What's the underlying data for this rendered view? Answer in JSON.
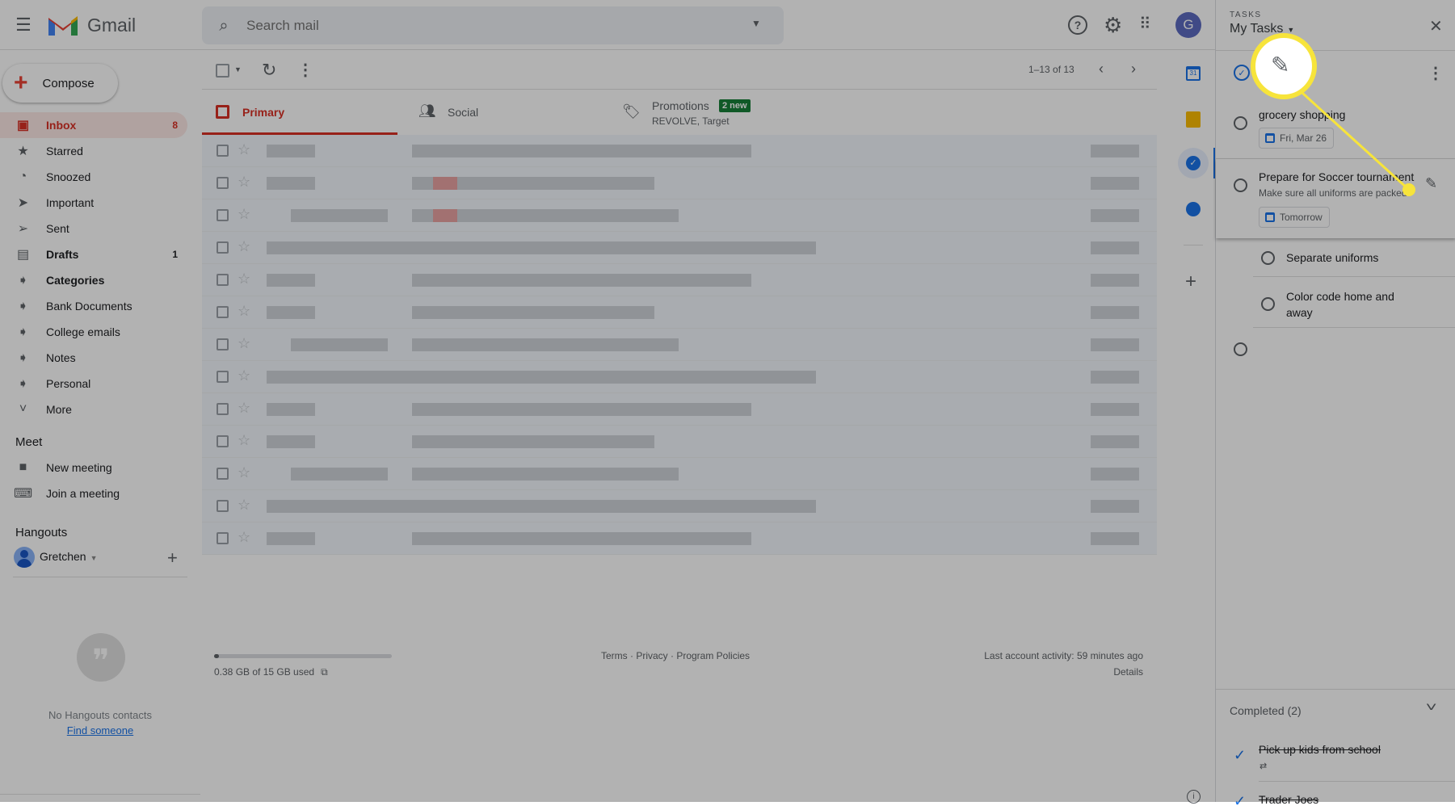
{
  "header": {
    "app_name": "Gmail",
    "search_placeholder": "Search mail",
    "avatar_letter": "G"
  },
  "sidebar": {
    "compose": "Compose",
    "items": [
      {
        "label": "Inbox",
        "count": "8",
        "icon": "inbox-icon",
        "active": true,
        "bold": true
      },
      {
        "label": "Starred",
        "count": "",
        "icon": "star-icon"
      },
      {
        "label": "Snoozed",
        "count": "",
        "icon": "clock-icon"
      },
      {
        "label": "Important",
        "count": "",
        "icon": "important-icon"
      },
      {
        "label": "Sent",
        "count": "",
        "icon": "send-icon"
      },
      {
        "label": "Drafts",
        "count": "1",
        "icon": "draft-icon",
        "bold": true
      },
      {
        "label": "Categories",
        "count": "",
        "icon": "label-icon",
        "bold": true
      },
      {
        "label": "Bank Documents",
        "count": "",
        "icon": "label-icon"
      },
      {
        "label": "College emails",
        "count": "",
        "icon": "label-icon"
      },
      {
        "label": "Notes",
        "count": "",
        "icon": "label-icon"
      },
      {
        "label": "Personal",
        "count": "",
        "icon": "label-icon"
      },
      {
        "label": "More",
        "count": "",
        "icon": "chevron-down-icon"
      }
    ],
    "meet": {
      "title": "Meet",
      "new_meeting": "New meeting",
      "join": "Join a meeting"
    },
    "hangouts": {
      "title": "Hangouts",
      "user": "Gretchen",
      "empty": "No Hangouts contacts",
      "find": "Find someone"
    }
  },
  "toolbar": {
    "pagination": "1–13 of 13"
  },
  "tabs": [
    {
      "label": "Primary",
      "active": true
    },
    {
      "label": "Social"
    },
    {
      "label": "Promotions",
      "badge": "2 new",
      "sub": "REVOLVE, Target"
    }
  ],
  "footer": {
    "storage": "0.38 GB of 15 GB used",
    "storage_fraction": 0.025,
    "links": "Terms · Privacy · Program Policies",
    "activity": "Last account activity: 59 minutes ago",
    "details": "Details"
  },
  "tasks": {
    "label": "TASKS",
    "list": "My Tasks",
    "items": [
      {
        "title": "grocery shopping",
        "date": "Fri, Mar 26"
      },
      {
        "title": "Prepare for Soccer tournament",
        "notes": "Make sure all uniforms are packed",
        "date": "Tomorrow",
        "subtasks": [
          "Separate uniforms",
          "Color code home and away"
        ]
      }
    ],
    "completed_label": "Completed (2)",
    "completed": [
      "Pick up kids from school",
      "Trader Joes"
    ]
  },
  "colors": {
    "accent_red": "#d93025",
    "badge_green": "#188038",
    "highlight_yellow": "#f7e43b",
    "blue": "#1a73e8"
  }
}
